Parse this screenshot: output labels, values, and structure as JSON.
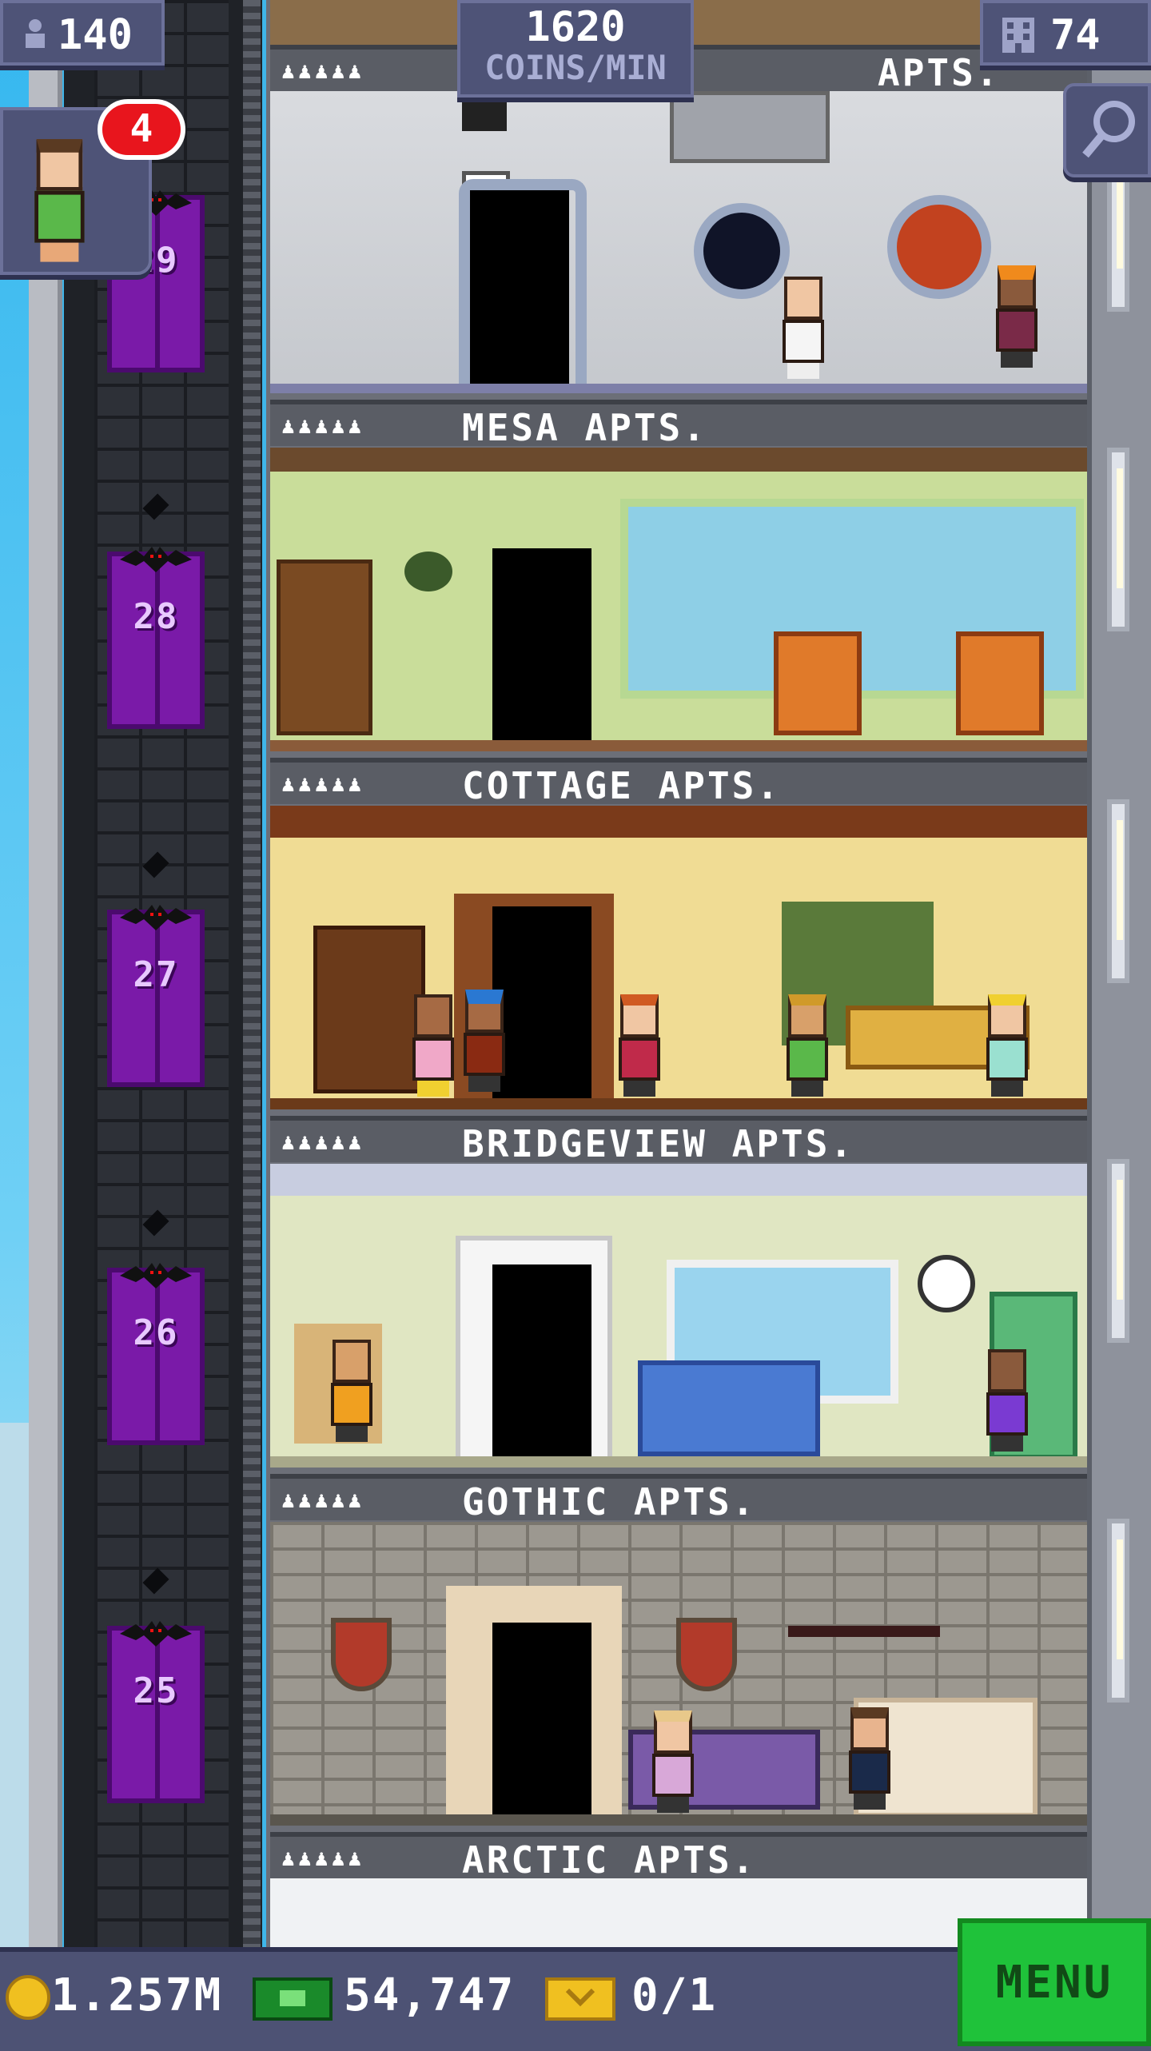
{
  "hud": {
    "population": "140",
    "coins_rate_value": "1620",
    "coins_rate_unit": "COINS/MIN",
    "floors_count": "74",
    "notification_count": "4"
  },
  "floors": [
    {
      "id": "top",
      "label": "APTS.",
      "people_icons": "♟♟♟♟♟"
    },
    {
      "id": "mesa",
      "label": "MESA APTS.",
      "people_icons": "♟♟♟♟♟"
    },
    {
      "id": "cottage",
      "label": "COTTAGE APTS.",
      "people_icons": "♟♟♟♟♟"
    },
    {
      "id": "bridgeview",
      "label": "BRIDGEVIEW APTS.",
      "people_icons": "♟♟♟♟♟"
    },
    {
      "id": "gothic",
      "label": "GOTHIC APTS.",
      "people_icons": "♟♟♟♟♟"
    },
    {
      "id": "arctic",
      "label": "ARCTIC APTS.",
      "people_icons": "♟♟♟♟♟"
    }
  ],
  "elevator_floors": [
    "29",
    "28",
    "27",
    "26",
    "25"
  ],
  "bottom_bar": {
    "coins": "1.257M",
    "bux": "54,747",
    "vip": "0/1",
    "menu_label": "MENU"
  },
  "colors": {
    "hud_bg": "#4e5377",
    "elevator": "#7a1aa8",
    "menu_green": "#1fc23a",
    "badge_red": "#e8151d"
  },
  "icons": {
    "population": "person-icon",
    "floors": "building-icon",
    "search": "magnifier-icon",
    "coins": "coin-icon",
    "bux": "cash-icon",
    "vip": "ticket-icon"
  }
}
